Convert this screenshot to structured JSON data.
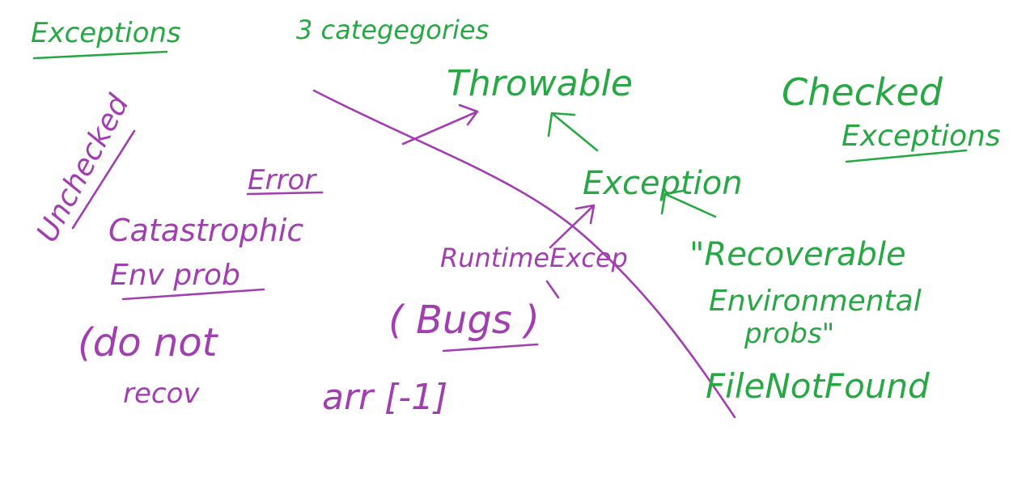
{
  "canvas": {
    "background": "#ffffff",
    "ink_colors": {
      "green": "#28a745",
      "purple": "#a23fb0"
    }
  },
  "notes": {
    "title": "Exceptions",
    "categories": "3 categegories",
    "throwable": "Throwable",
    "checked_line1": "Checked",
    "checked_line2": "Exceptions",
    "unchecked": "Unchecked",
    "error": "Error",
    "catastrophic": "Catastrophic",
    "env_prob": "Env prob",
    "do_not_1": "(do not",
    "do_not_2": "recov",
    "exception": "Exception",
    "runtime_exception": "RuntimeExcep",
    "bugs": "( Bugs )",
    "array_example": "arr [-1]",
    "recoverable_1": "\"Recoverable",
    "recoverable_2": "Environmental",
    "recoverable_3": "probs\"",
    "file_not_found": "FileNotFound"
  }
}
